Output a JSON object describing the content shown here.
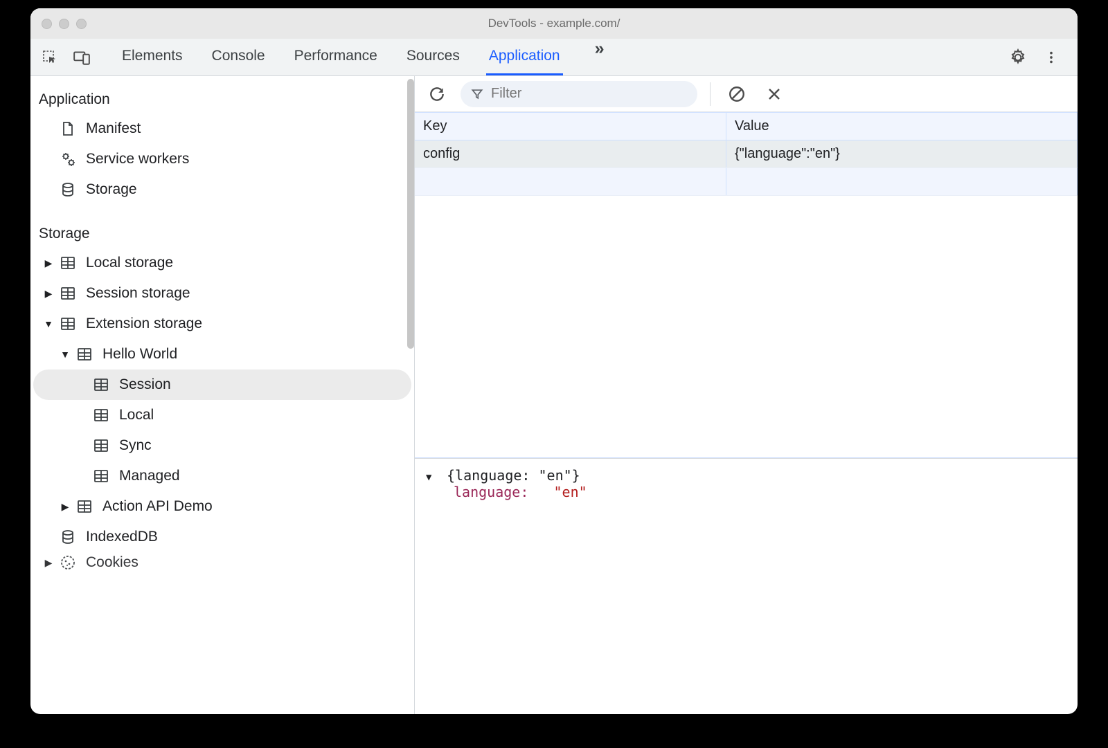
{
  "window": {
    "title": "DevTools - example.com/"
  },
  "tabs": {
    "items": [
      "Elements",
      "Console",
      "Performance",
      "Sources",
      "Application"
    ],
    "active_index": 4
  },
  "sidebar": {
    "sections": [
      {
        "title": "Application",
        "items": [
          {
            "icon": "file-icon",
            "label": "Manifest"
          },
          {
            "icon": "gears-icon",
            "label": "Service workers"
          },
          {
            "icon": "database-icon",
            "label": "Storage"
          }
        ]
      },
      {
        "title": "Storage",
        "items": [
          {
            "expander": "right",
            "icon": "table-icon",
            "label": "Local storage",
            "indent": 1
          },
          {
            "expander": "right",
            "icon": "table-icon",
            "label": "Session storage",
            "indent": 1
          },
          {
            "expander": "down",
            "icon": "table-icon",
            "label": "Extension storage",
            "indent": 1
          },
          {
            "expander": "down",
            "icon": "table-icon",
            "label": "Hello World",
            "indent": 2
          },
          {
            "icon": "table-icon",
            "label": "Session",
            "indent": 3,
            "selected": true
          },
          {
            "icon": "table-icon",
            "label": "Local",
            "indent": 3
          },
          {
            "icon": "table-icon",
            "label": "Sync",
            "indent": 3
          },
          {
            "icon": "table-icon",
            "label": "Managed",
            "indent": 3
          },
          {
            "expander": "right",
            "icon": "table-icon",
            "label": "Action API Demo",
            "indent": 2
          },
          {
            "icon": "database-icon",
            "label": "IndexedDB",
            "indent": 0,
            "pad": true
          },
          {
            "expander": "right",
            "icon": "cookie-icon",
            "label": "Cookies",
            "indent": 1,
            "cut": true
          }
        ]
      }
    ]
  },
  "toolbar": {
    "filter_placeholder": "Filter"
  },
  "table": {
    "headers": {
      "key": "Key",
      "value": "Value"
    },
    "rows": [
      {
        "key": "config",
        "value": "{\"language\":\"en\"}"
      }
    ]
  },
  "detail": {
    "summary": "{language: \"en\"}",
    "prop_key": "language:",
    "prop_val": "\"en\""
  }
}
